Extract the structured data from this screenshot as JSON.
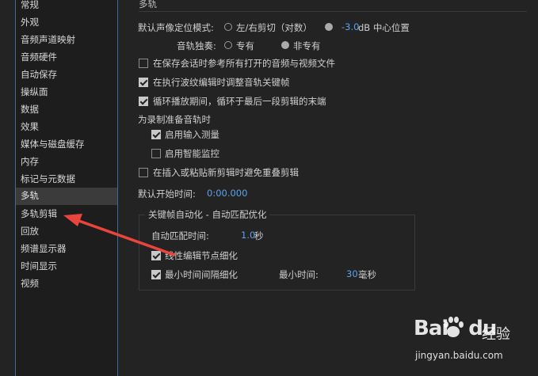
{
  "sidebar": {
    "items": [
      {
        "label": "常规"
      },
      {
        "label": "外观"
      },
      {
        "label": "音频声道映射"
      },
      {
        "label": "音频硬件"
      },
      {
        "label": "自动保存"
      },
      {
        "label": "操纵面"
      },
      {
        "label": "数据"
      },
      {
        "label": "效果"
      },
      {
        "label": "媒体与磁盘缓存"
      },
      {
        "label": "内存"
      },
      {
        "label": "标记与元数据"
      },
      {
        "label": "多轨"
      },
      {
        "label": "多轨剪辑"
      },
      {
        "label": "回放"
      },
      {
        "label": "频谱显示器"
      },
      {
        "label": "时间显示"
      },
      {
        "label": "视频"
      }
    ],
    "selected": "多轨"
  },
  "panel": {
    "title": "多轨",
    "pan_mode": {
      "label": "默认声像定位模式:",
      "option_left_right": "左/右剪切（对数）",
      "value": "-3.0",
      "unit_suffix": "dB 中心位置"
    },
    "track_solo": {
      "label": "音轨独奏:",
      "option_exclusive": "专有",
      "option_non_exclusive": "非专有"
    },
    "checkbox_save_refs": {
      "label": "在保存会话时参考所有打开的音频与视频文件",
      "checked": false
    },
    "checkbox_adjust_keyframes": {
      "label": "在执行波纹编辑时调整音轨关键帧",
      "checked": true
    },
    "checkbox_loop": {
      "label": "循环播放期间，循环于最后一段剪辑的末端",
      "checked": true
    },
    "record_prep": {
      "heading": "为录制准备音轨时",
      "checkbox_input_meter": {
        "label": "启用输入测量",
        "checked": true
      },
      "checkbox_smart_monitor": {
        "label": "启用智能监控",
        "checked": false
      }
    },
    "checkbox_avoid_overlap": {
      "label": "在插入或粘贴新剪辑时避免重叠剪辑",
      "checked": false
    },
    "default_start": {
      "label": "默认开始时间:",
      "value": "0:00.000"
    },
    "keyframe_group": {
      "legend": "关键帧自动化 - 自动匹配优化",
      "auto_match_label": "自动匹配时间:",
      "auto_match_value": "1.0",
      "auto_match_unit": "秒",
      "checkbox_linear": {
        "label": "线性编辑节点细化",
        "checked": true
      },
      "checkbox_min_interval": {
        "label": "最小时间间隔细化",
        "checked": true
      },
      "min_time_label": "最小时间:",
      "min_time_value": "30",
      "min_time_unit": "毫秒"
    }
  },
  "watermark": {
    "logo": "Bai",
    "logo_tail": "du",
    "name": "经验",
    "url": "jingyan.baidu.com"
  },
  "colors": {
    "accent": "#5aa3ea",
    "arrow": "#e8453c",
    "background": "#232323",
    "selection": "#3b3b3b"
  }
}
